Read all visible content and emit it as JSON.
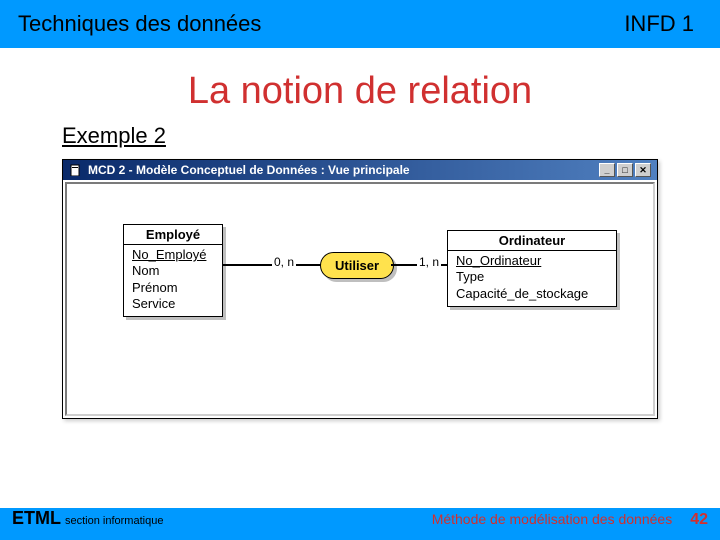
{
  "header": {
    "left": "Techniques des données",
    "right": "INFD 1"
  },
  "title": "La notion de relation",
  "subtitle": "Exemple 2",
  "mcd": {
    "window_title": "MCD 2 - Modèle Conceptuel de Données : Vue principale",
    "entity1": {
      "name": "Employé",
      "key": "No_Employé",
      "attr2": "Nom",
      "attr3": "Prénom",
      "attr4": "Service"
    },
    "relation": {
      "name": "Utiliser"
    },
    "card1": "0, n",
    "card2": "1, n",
    "entity2": {
      "name": "Ordinateur",
      "key": "No_Ordinateur",
      "attr2": "Type",
      "attr3": "Capacité_de_stockage"
    },
    "win_buttons": {
      "min": "_",
      "max": "□",
      "close": "✕"
    }
  },
  "footer": {
    "brand": "ETML",
    "section": "section informatique",
    "method": "Méthode de modélisation des données",
    "page": "42"
  }
}
